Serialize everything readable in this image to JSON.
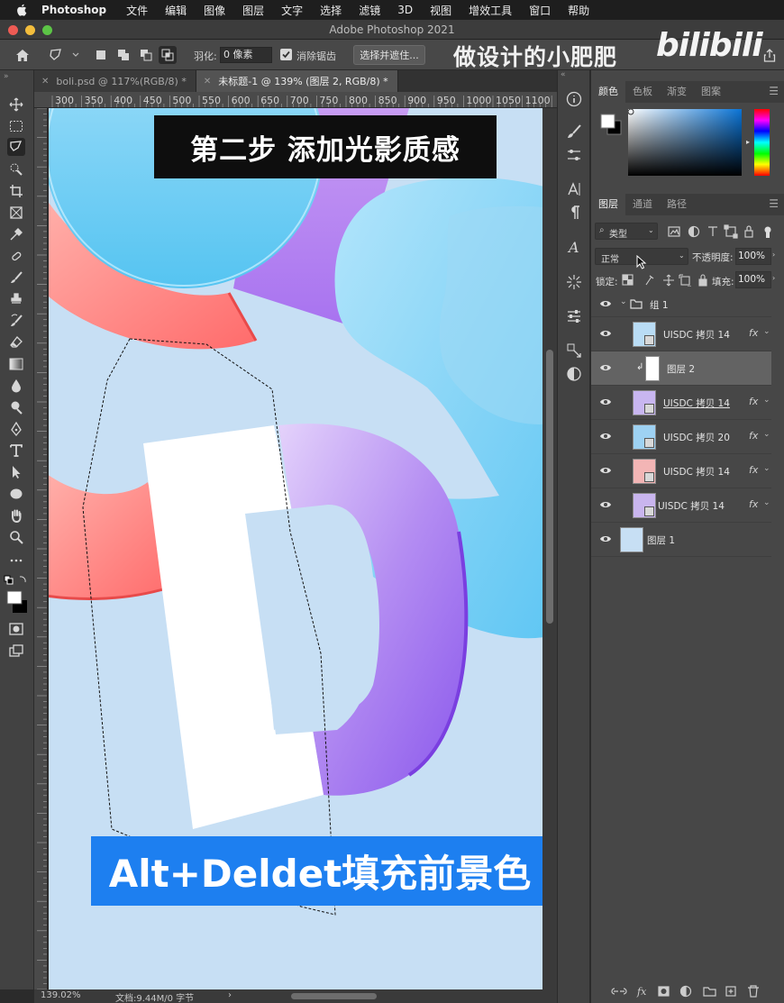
{
  "menubar": {
    "items": [
      "Photoshop",
      "文件",
      "编辑",
      "图像",
      "图层",
      "文字",
      "选择",
      "滤镜",
      "3D",
      "视图",
      "增效工具",
      "窗口",
      "帮助"
    ]
  },
  "window": {
    "title": "Adobe Photoshop 2021"
  },
  "options": {
    "feather_label": "羽化:",
    "feather_value": "0 像素",
    "antialias_label": "消除锯齿",
    "select_mask_label": "选择并遮住..."
  },
  "watermark": {
    "text": "做设计的小肥肥",
    "logo": "bilibili"
  },
  "tabs": [
    {
      "label": "boli.psd @ 117%(RGB/8) *",
      "active": false
    },
    {
      "label": "未标题-1 @ 139% (图层 2, RGB/8) *",
      "active": true
    }
  ],
  "ruler": {
    "ticks": [
      "300",
      "350",
      "400",
      "450",
      "500",
      "550",
      "600",
      "650",
      "700",
      "750",
      "800",
      "850",
      "900",
      "950",
      "1000",
      "1050",
      "1100"
    ]
  },
  "canvas": {
    "caption_top": "第二步 添加光影质感",
    "caption_bottom": "Alt+Deldet填充前景色"
  },
  "status": {
    "zoom": "139.02%",
    "doc": "文档:9.44M/0 字节",
    "arrow": "›"
  },
  "color_panel": {
    "tabs": [
      "颜色",
      "色板",
      "渐变",
      "图案"
    ],
    "foreground": "#ffffff",
    "background": "#000000",
    "hue_base": "#0a74d6"
  },
  "layers_panel": {
    "tabs": [
      "图层",
      "通道",
      "路径"
    ],
    "filter_kind": "类型",
    "blend_mode": "正常",
    "opacity_label": "不透明度:",
    "opacity_value": "100%",
    "lock_label": "锁定:",
    "fill_label": "填充:",
    "fill_value": "100%",
    "group_name": "组 1",
    "layers": [
      {
        "name": "UISDC 拷贝 14",
        "fx": "fx",
        "selected": false,
        "color": "#b9dcf5"
      },
      {
        "name": "图层 2",
        "fx": "",
        "selected": true,
        "color": "#ffffff"
      },
      {
        "name": "UISDC 拷贝 14",
        "fx": "fx",
        "selected": false,
        "color": "#c8b6f0"
      },
      {
        "name": "UISDC 拷贝 20",
        "fx": "fx",
        "selected": false,
        "color": "#9ed2f3"
      },
      {
        "name": "UISDC 拷贝 14",
        "fx": "fx",
        "selected": false,
        "color": "#f3b5b5"
      },
      {
        "name": "UISDC 拷贝 14",
        "fx": "fx",
        "selected": false,
        "color": "#c9b5ee"
      },
      {
        "name": "图层 1",
        "fx": "",
        "selected": false,
        "color": "#c7dff4"
      }
    ]
  },
  "icons": {
    "toolbar": [
      "move-icon",
      "marquee-icon",
      "polygonal-lasso-icon",
      "quick-select-icon",
      "crop-icon",
      "frame-icon",
      "eyedropper-icon",
      "healing-brush-icon",
      "brush-icon",
      "stamp-icon",
      "history-brush-icon",
      "eraser-icon",
      "gradient-icon",
      "blur-icon",
      "dodge-icon",
      "pen-icon",
      "type-icon",
      "path-select-icon",
      "ellipse-icon",
      "hand-icon",
      "zoom-icon",
      "more-icon",
      "color-swatch-icon",
      "quick-mask-icon",
      "screen-mode-icon"
    ]
  }
}
